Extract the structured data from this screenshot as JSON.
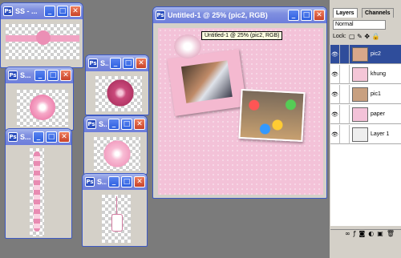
{
  "windows": {
    "w1": {
      "title": "SS - ..."
    },
    "w2": {
      "title": "S..."
    },
    "w3": {
      "title": "S..."
    },
    "w4": {
      "title": "S..."
    },
    "w5": {
      "title": "S..."
    },
    "w6": {
      "title": "S..."
    },
    "w7": {
      "title": "S..."
    },
    "main": {
      "title": "Untitled-1 @ 25% (pic2, RGB)"
    }
  },
  "tooltip": "Untitled-1 @ 25% (pic2, RGB)",
  "layers_panel": {
    "tabs": [
      "Layers",
      "Channels"
    ],
    "blend_mode": "Normal",
    "lock_label": "Lock:",
    "items": [
      {
        "name": "pic2",
        "selected": true
      },
      {
        "name": "khung",
        "selected": false
      },
      {
        "name": "pic1",
        "selected": false
      },
      {
        "name": "paper",
        "selected": false
      },
      {
        "name": "Layer 1",
        "selected": false
      }
    ]
  },
  "colors": {
    "titlebar": "#7f8fe0",
    "canvas_bg": "#f3c2d8",
    "frame": "#f4b9d0",
    "flower": "#c94a7b"
  }
}
